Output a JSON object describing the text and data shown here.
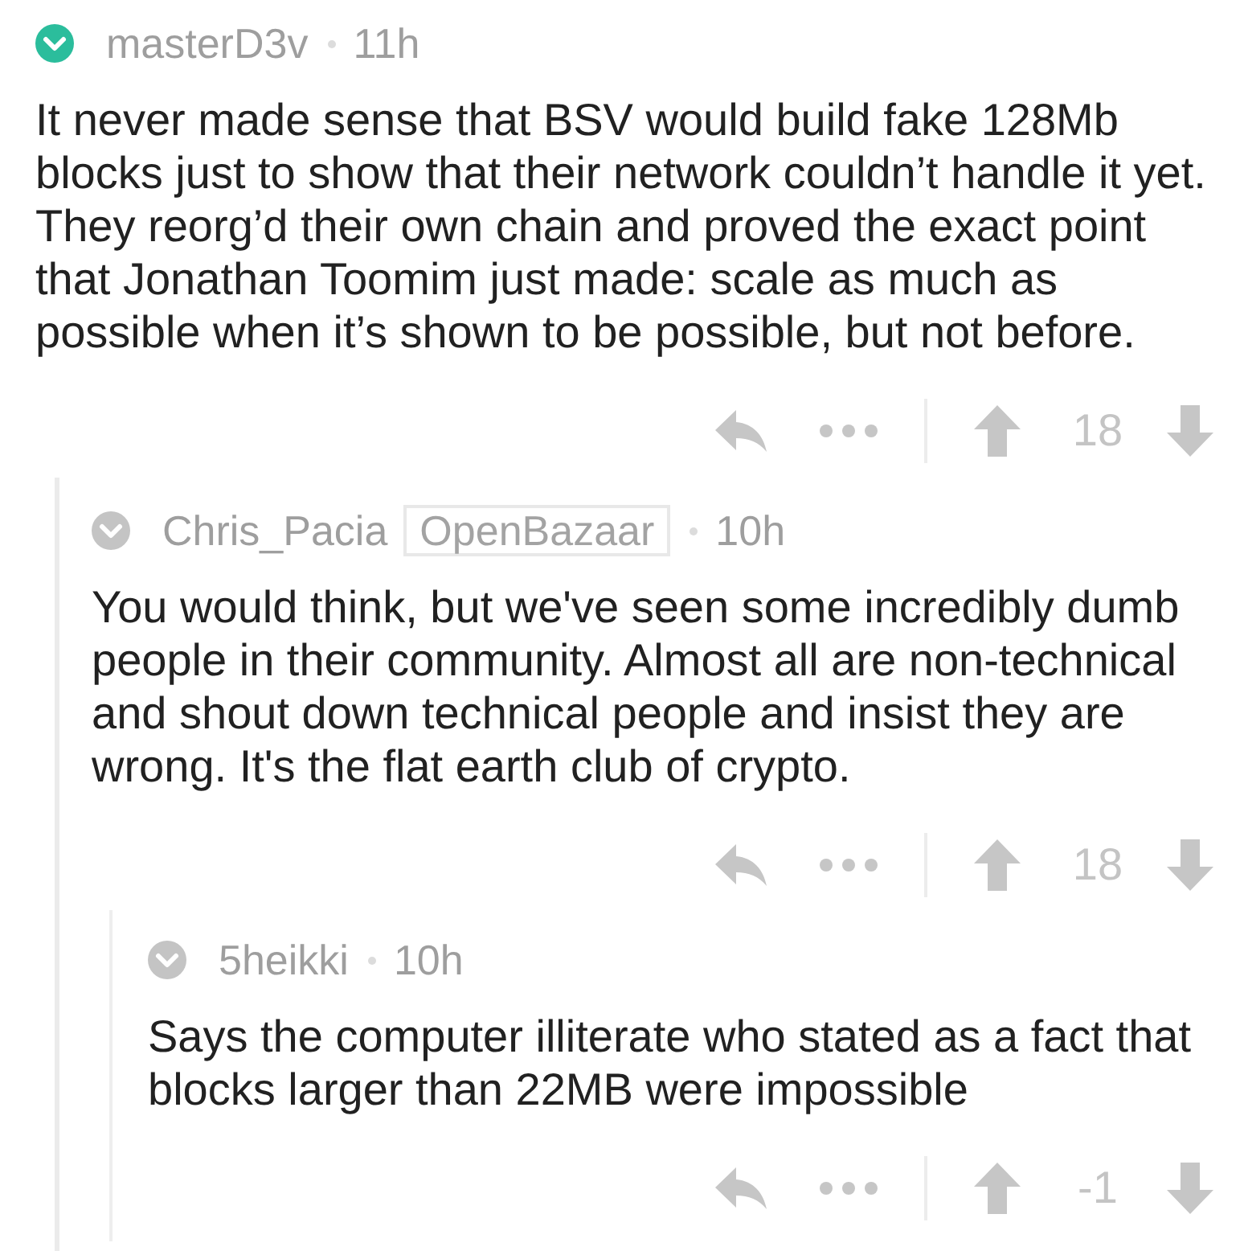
{
  "comments": [
    {
      "author": "masterD3v",
      "color": "#2bbd9c",
      "time": "11h",
      "body": "It never made sense that BSV would build fake 128Mb\nblocks just to show that their network couldn’t handle it yet.\nThey reorg’d their own chain and proved the exact point\nthat Jonathan Toomim just made: scale as much as\npossible when it’s shown to be possible, but not before.",
      "score": "18",
      "children": [
        {
          "author": "Chris_Pacia",
          "flair": "OpenBazaar",
          "color": "#c4c4c4",
          "time": "10h",
          "body": "You would think, but we've seen some incredibly dumb\npeople in their community. Almost all are non-technical\nand shout down technical people and insist they are\nwrong. It's the flat earth club of crypto.",
          "score": "18",
          "children": [
            {
              "author": "5heikki",
              "color": "#c4c4c4",
              "time": "10h",
              "body": "Says the computer illiterate who stated as a fact that\nblocks larger than 22MB were impossible",
              "score": "-1"
            }
          ]
        }
      ]
    }
  ]
}
